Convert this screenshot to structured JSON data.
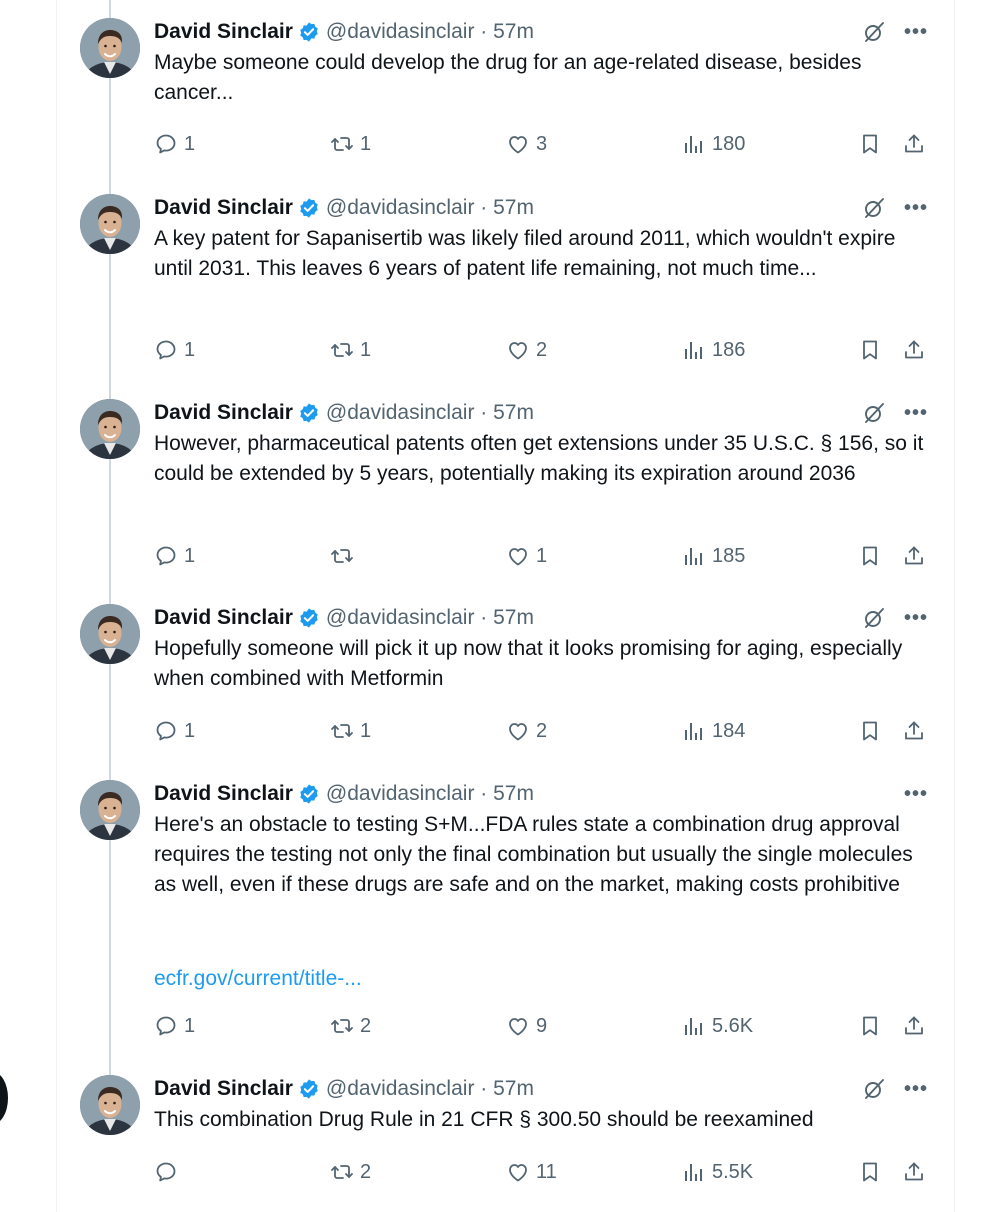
{
  "tweets": [
    {
      "name": "David Sinclair",
      "handle": "@davidasinclair",
      "time": "57m",
      "text": "Maybe someone could develop the drug for an age-related disease, besides cancer...",
      "link": "",
      "replies": "1",
      "retweets": "1",
      "likes": "3",
      "views": "180",
      "show_grok": true
    },
    {
      "name": "David Sinclair",
      "handle": "@davidasinclair",
      "time": "57m",
      "text": "A key patent for Sapanisertib was likely filed around 2011, which wouldn't expire until 2031. This leaves 6 years of patent life remaining, not much time...",
      "link": "",
      "replies": "1",
      "retweets": "1",
      "likes": "2",
      "views": "186",
      "show_grok": true
    },
    {
      "name": "David Sinclair",
      "handle": "@davidasinclair",
      "time": "57m",
      "text": "However, pharmaceutical patents often get extensions under 35 U.S.C. § 156, so it could be extended by 5 years, potentially making its expiration around 2036",
      "link": "",
      "replies": "1",
      "retweets": "",
      "likes": "1",
      "views": "185",
      "show_grok": true
    },
    {
      "name": "David Sinclair",
      "handle": "@davidasinclair",
      "time": "57m",
      "text": "Hopefully someone will pick it up now that it looks promising for aging, especially when combined with Metformin",
      "link": "",
      "replies": "1",
      "retweets": "1",
      "likes": "2",
      "views": "184",
      "show_grok": true
    },
    {
      "name": "David Sinclair",
      "handle": "@davidasinclair",
      "time": "57m",
      "text": "Here's an obstacle to testing S+M...FDA rules state a combination drug approval requires the testing not only the final combination but usually the single molecules as well, even if these drugs are safe and on the market, making costs prohibitive",
      "link": "ecfr.gov/current/title-...",
      "replies": "1",
      "retweets": "2",
      "likes": "9",
      "views": "5.6K",
      "show_grok": false
    },
    {
      "name": "David Sinclair",
      "handle": "@davidasinclair",
      "time": "57m",
      "text": "This combination Drug Rule in 21 CFR § 300.50 should be reexamined",
      "link": "",
      "replies": "",
      "retweets": "2",
      "likes": "11",
      "views": "5.5K",
      "show_grok": true
    }
  ],
  "separator": " · ",
  "colors": {
    "text": "#0f1419",
    "secondary": "#536471",
    "link": "#1d9bf0",
    "verified": "#1d9bf0",
    "thread_line": "#cfd9de"
  },
  "icons": {
    "reply": "reply-icon",
    "retweet": "retweet-icon",
    "like": "heart-icon",
    "views": "views-icon",
    "bookmark": "bookmark-icon",
    "share": "share-icon",
    "grok": "grok-icon",
    "more": "more-icon",
    "verified": "verified-badge-icon"
  }
}
